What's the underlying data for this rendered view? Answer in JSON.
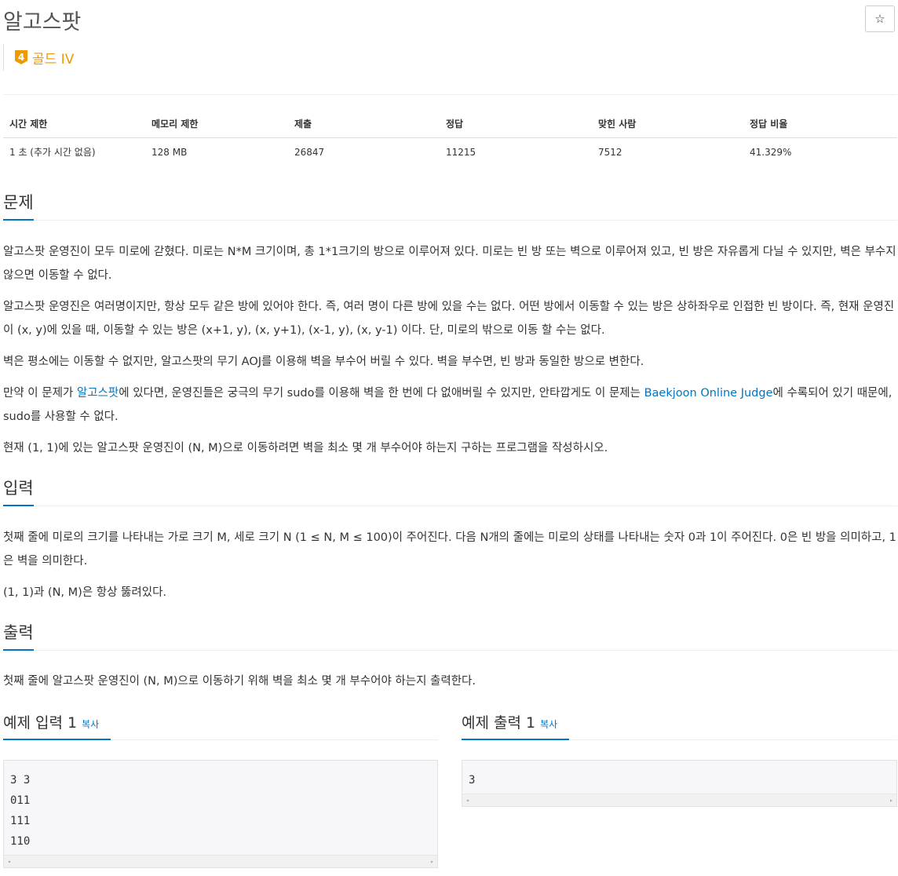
{
  "problem": {
    "title": "알고스팟",
    "star_icon": "☆",
    "tier": {
      "number": "4",
      "label": "골드 IV",
      "color": "#ec9a00"
    }
  },
  "info_table": {
    "headers": [
      "시간 제한",
      "메모리 제한",
      "제출",
      "정답",
      "맞힌 사람",
      "정답 비율"
    ],
    "values": [
      "1 초 (추가 시간 없음)",
      "128 MB",
      "26847",
      "11215",
      "7512",
      "41.329%"
    ]
  },
  "sections": {
    "problem_title": "문제",
    "problem_paragraphs": {
      "p1": "알고스팟 운영진이 모두 미로에 갇혔다. 미로는 N*M 크기이며, 총 1*1크기의 방으로 이루어져 있다. 미로는 빈 방 또는 벽으로 이루어져 있고, 빈 방은 자유롭게 다닐 수 있지만, 벽은 부수지 않으면 이동할 수 없다.",
      "p2": "알고스팟 운영진은 여러명이지만, 항상 모두 같은 방에 있어야 한다. 즉, 여러 명이 다른 방에 있을 수는 없다. 어떤 방에서 이동할 수 있는 방은 상하좌우로 인접한 빈 방이다. 즉, 현재 운영진이 (x, y)에 있을 때, 이동할 수 있는 방은 (x+1, y), (x, y+1), (x-1, y), (x, y-1) 이다. 단, 미로의 밖으로 이동 할 수는 없다.",
      "p3": "벽은 평소에는 이동할 수 없지만, 알고스팟의 무기 AOJ를 이용해 벽을 부수어 버릴 수 있다. 벽을 부수면, 빈 방과 동일한 방으로 변한다.",
      "p4_a": "만약 이 문제가 ",
      "p4_link1": "알고스팟",
      "p4_b": "에 있다면, 운영진들은 궁극의 무기 sudo를 이용해 벽을 한 번에 다 없애버릴 수 있지만, 안타깝게도 이 문제는 ",
      "p4_link2": "Baekjoon Online Judge",
      "p4_c": "에 수록되어 있기 때문에, sudo를 사용할 수 없다.",
      "p5": "현재 (1, 1)에 있는 알고스팟 운영진이 (N, M)으로 이동하려면 벽을 최소 몇 개 부수어야 하는지 구하는 프로그램을 작성하시오."
    },
    "input_title": "입력",
    "input_paragraphs": {
      "p1": "첫째 줄에 미로의 크기를 나타내는 가로 크기 M, 세로 크기 N (1 ≤ N, M ≤ 100)이 주어진다. 다음 N개의 줄에는 미로의 상태를 나타내는 숫자 0과 1이 주어진다. 0은 빈 방을 의미하고, 1은 벽을 의미한다.",
      "p2": "(1, 1)과 (N, M)은 항상 뚫려있다."
    },
    "output_title": "출력",
    "output_paragraph": "첫째 줄에 알고스팟 운영진이 (N, M)으로 이동하기 위해 벽을 최소 몇 개 부수어야 하는지 출력한다."
  },
  "samples": {
    "input_title": "예제 입력 1",
    "output_title": "예제 출력 1",
    "copy_label": "복사",
    "input_code": "3 3\n011\n111\n110",
    "output_code": "3",
    "scroll_left": "◂",
    "scroll_right": "▸"
  },
  "colors": {
    "link": "#0076c0",
    "tier": "#ec9a00",
    "accent_underline": "#0076c0"
  }
}
